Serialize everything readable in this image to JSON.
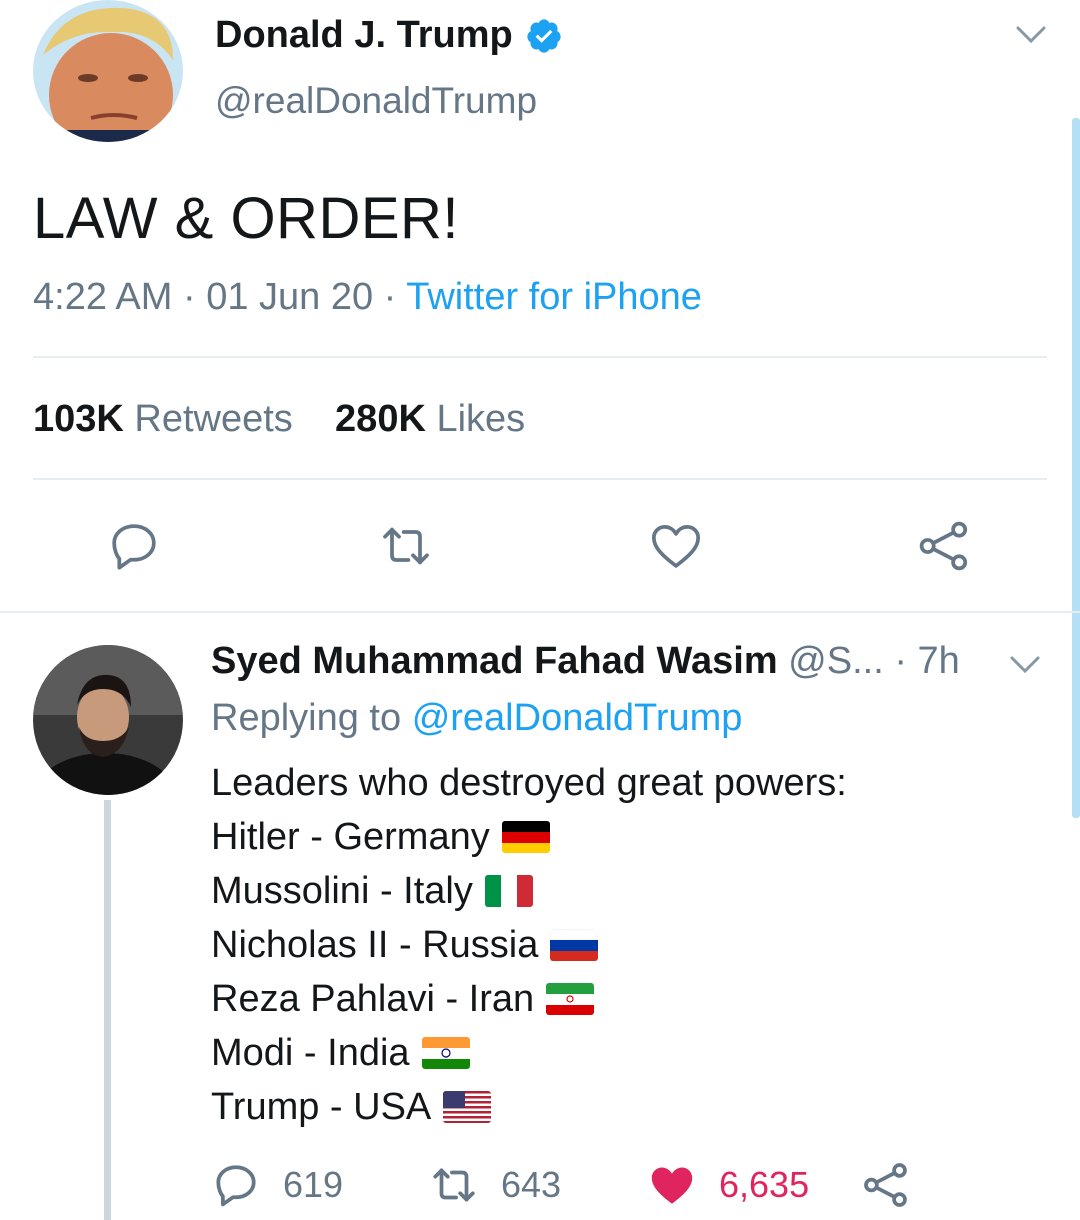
{
  "main_tweet": {
    "author_name": "Donald J. Trump",
    "handle": "@realDonaldTrump",
    "text": "LAW & ORDER!",
    "time": "4:22 AM",
    "sep1": " · ",
    "date": "01 Jun 20",
    "sep2": " · ",
    "source": "Twitter for iPhone",
    "retweet_count": "103K",
    "retweet_label": "Retweets",
    "like_count": "280K",
    "like_label": "Likes"
  },
  "reply": {
    "author_name": "Syed Muhammad Fahad Wasim",
    "handle": "@S...",
    "time": " · 7h",
    "replying_prefix": "Replying to",
    "replying_to": "@realDonaldTrump",
    "lines": [
      "Leaders who destroyed great powers:",
      "Hitler - Germany",
      "Mussolini - Italy",
      "Nicholas II - Russia",
      "Reza Pahlavi - Iran",
      "Modi - India",
      "Trump - USA"
    ],
    "reply_count": "619",
    "retweet_count": "643",
    "like_count": "6,635"
  },
  "colors": {
    "accent": "#1da1f2",
    "secondary_text": "#657786",
    "like": "#e0245e",
    "divider": "#e6ecf0"
  }
}
